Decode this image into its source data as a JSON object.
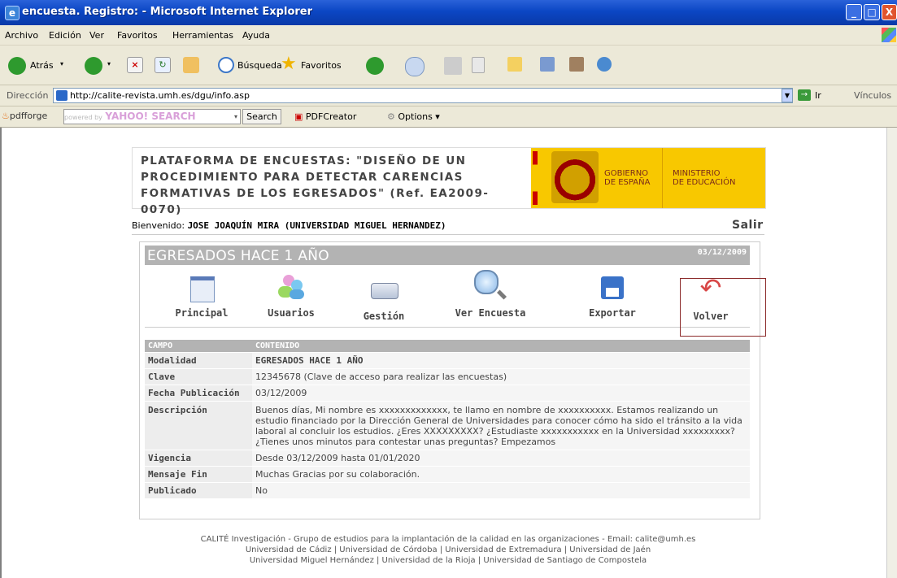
{
  "window": {
    "title": "encuesta. Registro: - Microsoft Internet Explorer",
    "min": "_",
    "max": "□",
    "close": "X"
  },
  "menu": [
    "Archivo",
    "Edición",
    "Ver",
    "Favoritos",
    "Herramientas",
    "Ayuda"
  ],
  "toolbar": {
    "back": "Atrás",
    "search": "Búsqueda",
    "favorites": "Favoritos"
  },
  "address": {
    "label": "Dirección",
    "url": "http://calite-revista.umh.es/dgu/info.asp",
    "go": "Ir",
    "links": "Vínculos"
  },
  "ybar": {
    "pdfforge": "pdfforge",
    "powered": "powered by",
    "yahoo": "YAHOO! SEARCH",
    "search_btn": "Search",
    "pdfcreator": "PDFCreator",
    "options": "Options"
  },
  "banner": {
    "text": "PLATAFORMA DE ENCUESTAS: \"DISEÑO DE UN PROCEDIMIENTO PARA DETECTAR CARENCIAS FORMATIVAS DE LOS EGRESADOS\" (Ref. EA2009-0070)",
    "gob1": "GOBIERNO",
    "gob2": "DE ESPAÑA",
    "min1": "MINISTERIO",
    "min2": "DE EDUCACIÓN"
  },
  "welcome": {
    "prefix": "Bienvenido: ",
    "user": "JOSE JOAQUÍN MIRA (UNIVERSIDAD MIGUEL HERNANDEZ)",
    "logout": "Salir"
  },
  "card": {
    "title": "EGRESADOS HACE 1 AÑO",
    "date": "03/12/2009"
  },
  "nav": {
    "principal": "Principal",
    "usuarios": "Usuarios",
    "gestion": "Gestión",
    "ver": "Ver Encuesta",
    "exportar": "Exportar",
    "volver": "Volver"
  },
  "table": {
    "h_campo": "CAMPO",
    "h_contenido": "CONTENIDO",
    "rows": [
      {
        "k": "Modalidad",
        "v": "EGRESADOS HACE 1 AÑO"
      },
      {
        "k": "Clave",
        "v": "12345678 (Clave de acceso para realizar las encuestas)"
      },
      {
        "k": "Fecha Publicación",
        "v": "03/12/2009"
      },
      {
        "k": "Descripción",
        "v": "Buenos días, Mi nombre es xxxxxxxxxxxxx, te llamo en nombre de xxxxxxxxxx. Estamos realizando un estudio financiado por la Dirección General de Universidades para conocer cómo ha sido el tránsito a la vida laboral al concluir los estudios. ¿Eres XXXXXXXXX? ¿Estudiaste xxxxxxxxxxx en la Universidad xxxxxxxxx? ¿Tienes unos minutos para contestar unas preguntas? Empezamos"
      },
      {
        "k": "Vigencia",
        "v": "Desde 03/12/2009 hasta  01/01/2020"
      },
      {
        "k": "Mensaje Fin",
        "v": "Muchas Gracias por su colaboración."
      },
      {
        "k": "Publicado",
        "v": "No"
      }
    ]
  },
  "footer": {
    "line1": "CALITÉ Investigación - Grupo de estudios para la implantación de la calidad en las organizaciones - Email: calite@umh.es",
    "line2": "Universidad de Cádiz | Universidad de Córdoba | Universidad de Extremadura | Universidad de Jaén",
    "line3": "Universidad Miguel Hernández | Universidad de la Rioja | Universidad de Santiago de Compostela"
  },
  "colors": {
    "titlebar": "#0b46c4",
    "card_header": "#b3b3b3",
    "gold": "#f8c800",
    "volver_border": "#8b2a2a"
  },
  "icons": [
    "ie-icon",
    "back-arrow-icon",
    "forward-arrow-icon",
    "stop-icon",
    "refresh-icon",
    "home-icon",
    "search-icon",
    "star-icon",
    "history-icon",
    "mail-icon",
    "print-icon",
    "page-icon",
    "folder-icon",
    "msn-icon",
    "users-icon",
    "document-icon",
    "drive-icon",
    "magnifier-icon",
    "floppy-icon",
    "return-arrow-icon"
  ]
}
